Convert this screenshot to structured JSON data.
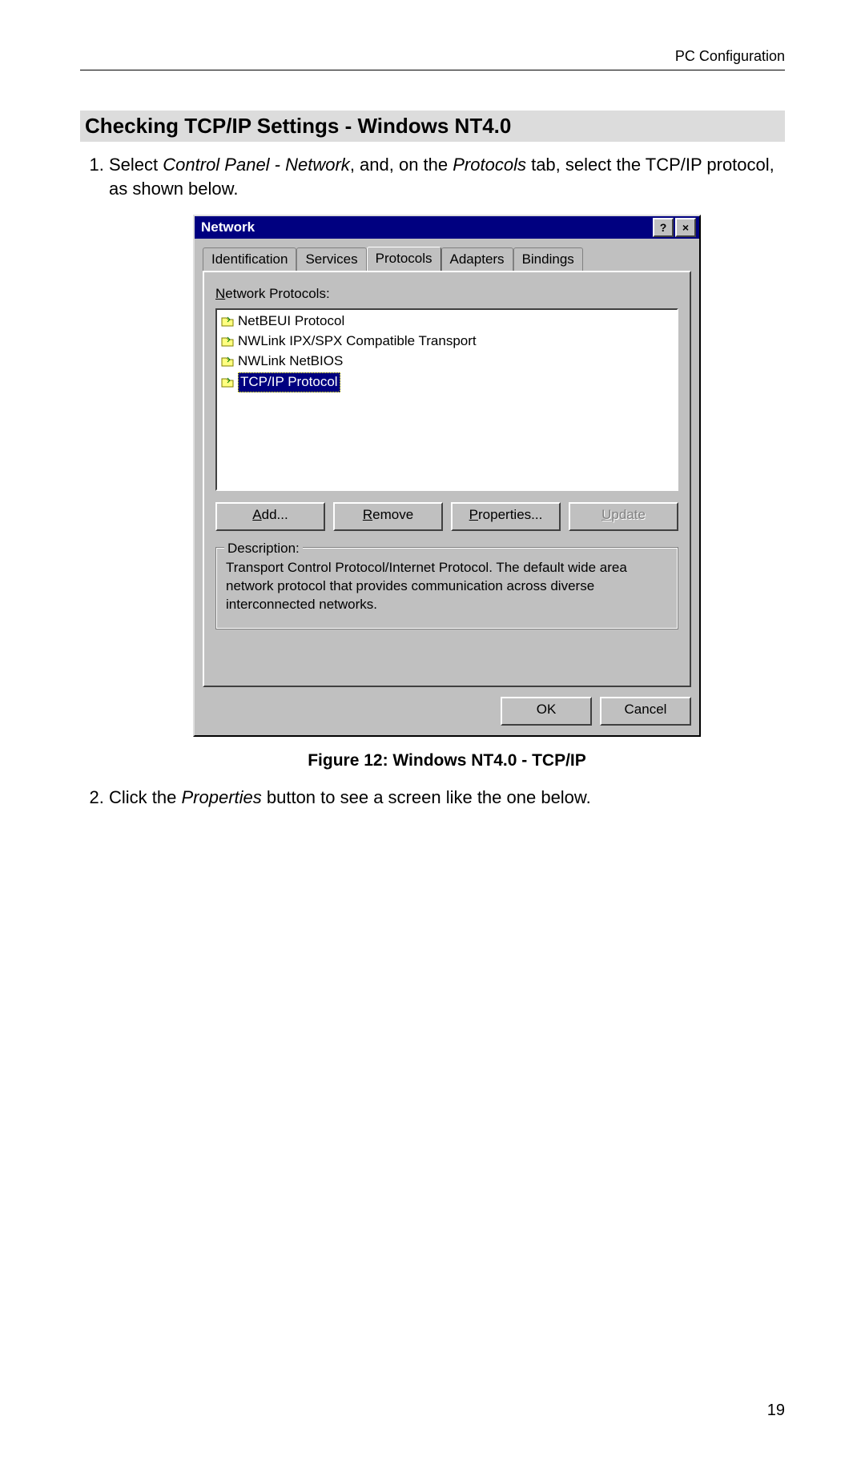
{
  "header": {
    "section": "PC Configuration"
  },
  "heading": "Checking TCP/IP Settings - Windows NT4.0",
  "step1": {
    "pre": "Select ",
    "i1": "Control Panel - Network",
    "mid": ", and, on the ",
    "i2": "Protocols",
    "post": " tab, select the TCP/IP protocol, as shown below."
  },
  "dialog": {
    "title": "Network",
    "help": "?",
    "close": "×",
    "tabs": {
      "identification": "Identification",
      "services": "Services",
      "protocols": "Protocols",
      "adapters": "Adapters",
      "bindings": "Bindings"
    },
    "list_label": "Network Protocols:",
    "list_label_ul": "N",
    "protocols": [
      "NetBEUI Protocol",
      "NWLink IPX/SPX Compatible Transport",
      "NWLink NetBIOS",
      "TCP/IP Protocol"
    ],
    "buttons": {
      "add": "Add...",
      "add_ul": "A",
      "remove": "Remove",
      "remove_ul": "R",
      "properties": "Properties...",
      "properties_ul": "P",
      "update": "Update",
      "update_ul": "U"
    },
    "description_label": "Description:",
    "description": "Transport Control Protocol/Internet Protocol. The default wide area network protocol that provides communication across diverse interconnected networks.",
    "ok": "OK",
    "cancel": "Cancel"
  },
  "figure_caption": "Figure 12: Windows NT4.0 - TCP/IP",
  "step2": {
    "pre": "Click the ",
    "i1": "Properties",
    "post": " button to see a screen like the one below."
  },
  "page_number": "19"
}
